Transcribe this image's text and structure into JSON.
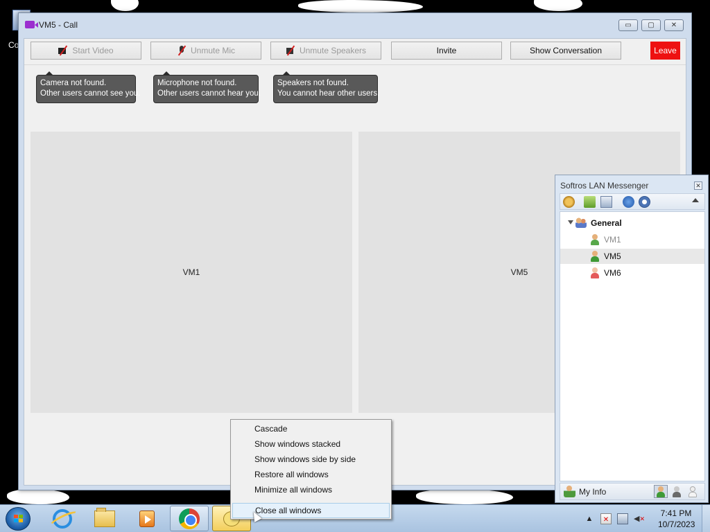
{
  "desktop": {
    "icon_label": "Co"
  },
  "call_window": {
    "title": "VM5 - Call",
    "window_buttons": {
      "minimize": "▭",
      "maximize": "▢",
      "close": "✕"
    },
    "toolbar": {
      "start_video": "Start Video",
      "unmute_mic": "Unmute Mic",
      "unmute_speakers": "Unmute Speakers",
      "invite": "Invite",
      "show_conversation": "Show Conversation",
      "leave": "Leave"
    },
    "tooltips": {
      "camera_line1": "Camera not found.",
      "camera_line2": "Other users cannot see you.",
      "mic_line1": "Microphone not found.",
      "mic_line2": "Other users cannot hear you.",
      "speakers_line1": "Speakers not found.",
      "speakers_line2": "You cannot hear other users."
    },
    "panes": {
      "left": "VM1",
      "right": "VM5"
    },
    "colors": {
      "leave": "#ee1111",
      "tooltip_bg": "#595959"
    }
  },
  "messenger": {
    "title": "Softros LAN Messenger",
    "close": "✕",
    "group": "General",
    "users": [
      {
        "name": "VM1",
        "status": "offline",
        "color": "#8a8a8a",
        "selected": false
      },
      {
        "name": "VM5",
        "status": "online",
        "color": "#111111",
        "selected": true
      },
      {
        "name": "VM6",
        "status": "busy",
        "color": "#111111",
        "selected": false
      }
    ],
    "my_info": "My Info",
    "icons": [
      "settings-icon",
      "add-folder-icon",
      "history-icon",
      "help-icon",
      "info-icon",
      "collapse-icon"
    ]
  },
  "context_menu": {
    "items": [
      "Cascade",
      "Show windows stacked",
      "Show windows side by side",
      "Restore all windows",
      "Minimize all windows"
    ],
    "close_all": "Close all windows"
  },
  "taskbar": {
    "apps": [
      "start-icon",
      "internet-explorer-icon",
      "file-explorer-icon",
      "media-player-icon",
      "chrome-icon",
      "messenger-icon"
    ],
    "time": "7:41 PM",
    "date": "10/7/2023",
    "tray": {
      "show_hidden": "▲"
    }
  }
}
